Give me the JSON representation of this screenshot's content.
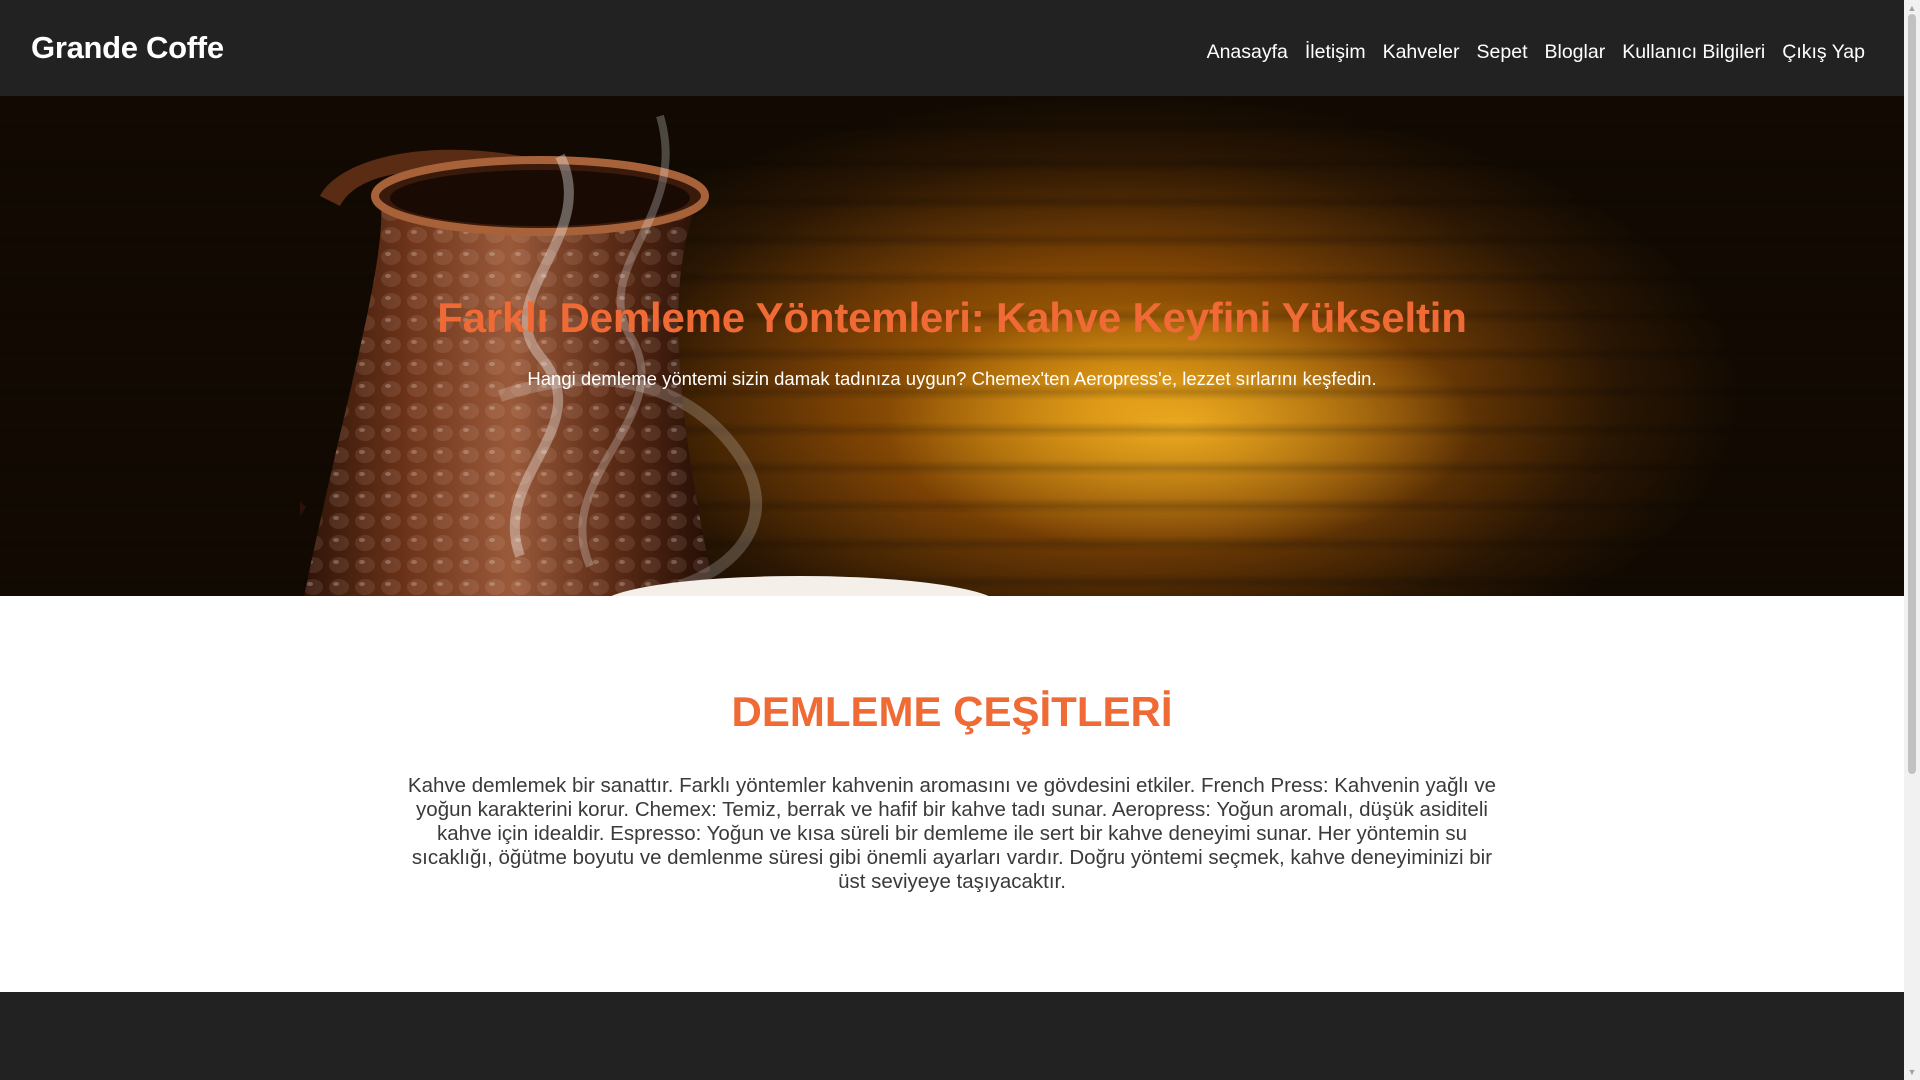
{
  "brand": "Grande Coffe",
  "nav": {
    "items": [
      "Anasayfa",
      "İletişim",
      "Kahveler",
      "Sepet",
      "Bloglar",
      "Kullanıcı Bilgileri",
      "Çıkış Yap"
    ]
  },
  "hero": {
    "title": "Farklı Demleme Yöntemleri: Kahve Keyfini Yükseltin",
    "subtitle": "Hangi demleme yöntemi sizin damak tadınıza uygun? Chemex'ten Aeropress'e, lezzet sırlarını keşfedin."
  },
  "section": {
    "title": "DEMLEME ÇEŞİTLERİ",
    "text": "Kahve demlemek bir sanattır. Farklı yöntemler kahvenin aromasını ve gövdesini etkiler. French Press: Kahvenin yağlı ve yoğun karakterini korur. Chemex: Temiz, berrak ve hafif bir kahve tadı sunar. Aeropress: Yoğun aromalı, düşük asiditeli kahve için idealdir. Espresso: Yoğun ve kısa süreli bir demleme ile sert bir kahve deneyimi sunar. Her yöntemin su sıcaklığı, öğütme boyutu ve demlenme süresi gibi önemli ayarları vardır. Doğru yöntemi seçmek, kahve deneyiminizi bir üst seviyeye taşıyacaktır."
  },
  "colors": {
    "accent": "#f06a35",
    "dark": "#222222"
  },
  "icons": {
    "scroll_up": "triangle-up-icon",
    "scroll_down": "triangle-down-icon"
  }
}
